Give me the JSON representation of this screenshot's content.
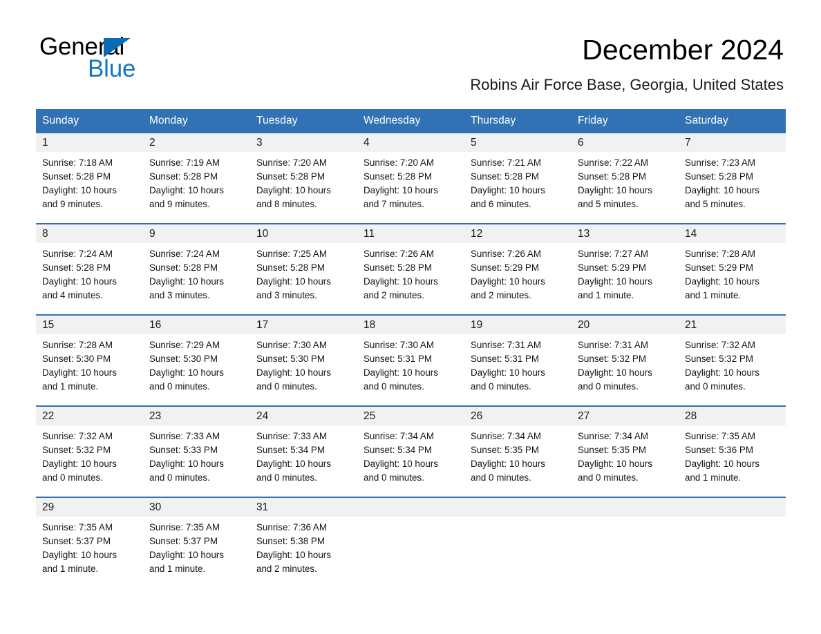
{
  "brand": {
    "name_part1": "General",
    "name_part2": "Blue",
    "triangle_color": "#0a6cb4",
    "blue_color": "#1376c4"
  },
  "header": {
    "month_title": "December 2024",
    "location": "Robins Air Force Base, Georgia, United States",
    "accent_color": "#3172b5",
    "daynum_background": "#f1f1f1"
  },
  "calendar": {
    "weekday_headers": [
      "Sunday",
      "Monday",
      "Tuesday",
      "Wednesday",
      "Thursday",
      "Friday",
      "Saturday"
    ],
    "weeks": [
      {
        "days": [
          {
            "num": "1",
            "sunrise": "Sunrise: 7:18 AM",
            "sunset": "Sunset: 5:28 PM",
            "daylight_line1": "Daylight: 10 hours",
            "daylight_line2": "and 9 minutes."
          },
          {
            "num": "2",
            "sunrise": "Sunrise: 7:19 AM",
            "sunset": "Sunset: 5:28 PM",
            "daylight_line1": "Daylight: 10 hours",
            "daylight_line2": "and 9 minutes."
          },
          {
            "num": "3",
            "sunrise": "Sunrise: 7:20 AM",
            "sunset": "Sunset: 5:28 PM",
            "daylight_line1": "Daylight: 10 hours",
            "daylight_line2": "and 8 minutes."
          },
          {
            "num": "4",
            "sunrise": "Sunrise: 7:20 AM",
            "sunset": "Sunset: 5:28 PM",
            "daylight_line1": "Daylight: 10 hours",
            "daylight_line2": "and 7 minutes."
          },
          {
            "num": "5",
            "sunrise": "Sunrise: 7:21 AM",
            "sunset": "Sunset: 5:28 PM",
            "daylight_line1": "Daylight: 10 hours",
            "daylight_line2": "and 6 minutes."
          },
          {
            "num": "6",
            "sunrise": "Sunrise: 7:22 AM",
            "sunset": "Sunset: 5:28 PM",
            "daylight_line1": "Daylight: 10 hours",
            "daylight_line2": "and 5 minutes."
          },
          {
            "num": "7",
            "sunrise": "Sunrise: 7:23 AM",
            "sunset": "Sunset: 5:28 PM",
            "daylight_line1": "Daylight: 10 hours",
            "daylight_line2": "and 5 minutes."
          }
        ]
      },
      {
        "days": [
          {
            "num": "8",
            "sunrise": "Sunrise: 7:24 AM",
            "sunset": "Sunset: 5:28 PM",
            "daylight_line1": "Daylight: 10 hours",
            "daylight_line2": "and 4 minutes."
          },
          {
            "num": "9",
            "sunrise": "Sunrise: 7:24 AM",
            "sunset": "Sunset: 5:28 PM",
            "daylight_line1": "Daylight: 10 hours",
            "daylight_line2": "and 3 minutes."
          },
          {
            "num": "10",
            "sunrise": "Sunrise: 7:25 AM",
            "sunset": "Sunset: 5:28 PM",
            "daylight_line1": "Daylight: 10 hours",
            "daylight_line2": "and 3 minutes."
          },
          {
            "num": "11",
            "sunrise": "Sunrise: 7:26 AM",
            "sunset": "Sunset: 5:28 PM",
            "daylight_line1": "Daylight: 10 hours",
            "daylight_line2": "and 2 minutes."
          },
          {
            "num": "12",
            "sunrise": "Sunrise: 7:26 AM",
            "sunset": "Sunset: 5:29 PM",
            "daylight_line1": "Daylight: 10 hours",
            "daylight_line2": "and 2 minutes."
          },
          {
            "num": "13",
            "sunrise": "Sunrise: 7:27 AM",
            "sunset": "Sunset: 5:29 PM",
            "daylight_line1": "Daylight: 10 hours",
            "daylight_line2": "and 1 minute."
          },
          {
            "num": "14",
            "sunrise": "Sunrise: 7:28 AM",
            "sunset": "Sunset: 5:29 PM",
            "daylight_line1": "Daylight: 10 hours",
            "daylight_line2": "and 1 minute."
          }
        ]
      },
      {
        "days": [
          {
            "num": "15",
            "sunrise": "Sunrise: 7:28 AM",
            "sunset": "Sunset: 5:30 PM",
            "daylight_line1": "Daylight: 10 hours",
            "daylight_line2": "and 1 minute."
          },
          {
            "num": "16",
            "sunrise": "Sunrise: 7:29 AM",
            "sunset": "Sunset: 5:30 PM",
            "daylight_line1": "Daylight: 10 hours",
            "daylight_line2": "and 0 minutes."
          },
          {
            "num": "17",
            "sunrise": "Sunrise: 7:30 AM",
            "sunset": "Sunset: 5:30 PM",
            "daylight_line1": "Daylight: 10 hours",
            "daylight_line2": "and 0 minutes."
          },
          {
            "num": "18",
            "sunrise": "Sunrise: 7:30 AM",
            "sunset": "Sunset: 5:31 PM",
            "daylight_line1": "Daylight: 10 hours",
            "daylight_line2": "and 0 minutes."
          },
          {
            "num": "19",
            "sunrise": "Sunrise: 7:31 AM",
            "sunset": "Sunset: 5:31 PM",
            "daylight_line1": "Daylight: 10 hours",
            "daylight_line2": "and 0 minutes."
          },
          {
            "num": "20",
            "sunrise": "Sunrise: 7:31 AM",
            "sunset": "Sunset: 5:32 PM",
            "daylight_line1": "Daylight: 10 hours",
            "daylight_line2": "and 0 minutes."
          },
          {
            "num": "21",
            "sunrise": "Sunrise: 7:32 AM",
            "sunset": "Sunset: 5:32 PM",
            "daylight_line1": "Daylight: 10 hours",
            "daylight_line2": "and 0 minutes."
          }
        ]
      },
      {
        "days": [
          {
            "num": "22",
            "sunrise": "Sunrise: 7:32 AM",
            "sunset": "Sunset: 5:32 PM",
            "daylight_line1": "Daylight: 10 hours",
            "daylight_line2": "and 0 minutes."
          },
          {
            "num": "23",
            "sunrise": "Sunrise: 7:33 AM",
            "sunset": "Sunset: 5:33 PM",
            "daylight_line1": "Daylight: 10 hours",
            "daylight_line2": "and 0 minutes."
          },
          {
            "num": "24",
            "sunrise": "Sunrise: 7:33 AM",
            "sunset": "Sunset: 5:34 PM",
            "daylight_line1": "Daylight: 10 hours",
            "daylight_line2": "and 0 minutes."
          },
          {
            "num": "25",
            "sunrise": "Sunrise: 7:34 AM",
            "sunset": "Sunset: 5:34 PM",
            "daylight_line1": "Daylight: 10 hours",
            "daylight_line2": "and 0 minutes."
          },
          {
            "num": "26",
            "sunrise": "Sunrise: 7:34 AM",
            "sunset": "Sunset: 5:35 PM",
            "daylight_line1": "Daylight: 10 hours",
            "daylight_line2": "and 0 minutes."
          },
          {
            "num": "27",
            "sunrise": "Sunrise: 7:34 AM",
            "sunset": "Sunset: 5:35 PM",
            "daylight_line1": "Daylight: 10 hours",
            "daylight_line2": "and 0 minutes."
          },
          {
            "num": "28",
            "sunrise": "Sunrise: 7:35 AM",
            "sunset": "Sunset: 5:36 PM",
            "daylight_line1": "Daylight: 10 hours",
            "daylight_line2": "and 1 minute."
          }
        ]
      },
      {
        "days": [
          {
            "num": "29",
            "sunrise": "Sunrise: 7:35 AM",
            "sunset": "Sunset: 5:37 PM",
            "daylight_line1": "Daylight: 10 hours",
            "daylight_line2": "and 1 minute."
          },
          {
            "num": "30",
            "sunrise": "Sunrise: 7:35 AM",
            "sunset": "Sunset: 5:37 PM",
            "daylight_line1": "Daylight: 10 hours",
            "daylight_line2": "and 1 minute."
          },
          {
            "num": "31",
            "sunrise": "Sunrise: 7:36 AM",
            "sunset": "Sunset: 5:38 PM",
            "daylight_line1": "Daylight: 10 hours",
            "daylight_line2": "and 2 minutes."
          },
          {
            "num": "",
            "sunrise": "",
            "sunset": "",
            "daylight_line1": "",
            "daylight_line2": ""
          },
          {
            "num": "",
            "sunrise": "",
            "sunset": "",
            "daylight_line1": "",
            "daylight_line2": ""
          },
          {
            "num": "",
            "sunrise": "",
            "sunset": "",
            "daylight_line1": "",
            "daylight_line2": ""
          },
          {
            "num": "",
            "sunrise": "",
            "sunset": "",
            "daylight_line1": "",
            "daylight_line2": ""
          }
        ]
      }
    ]
  }
}
